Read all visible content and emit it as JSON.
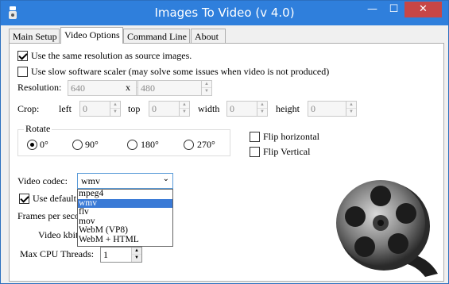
{
  "window": {
    "title": "Images To Video (v 4.0)",
    "minimize": "—",
    "maximize": "☐",
    "close": "✕"
  },
  "tabs": [
    "Main Setup",
    "Video Options",
    "Command Line",
    "About"
  ],
  "options": {
    "same_resolution": {
      "label": "Use the same resolution as source images.",
      "checked": true
    },
    "slow_scaler": {
      "label": "Use slow software scaler (may solve some issues when video is not produced)",
      "checked": false
    }
  },
  "resolution": {
    "label": "Resolution:",
    "width": "640",
    "x_sep": "x",
    "height": "480"
  },
  "crop": {
    "label": "Crop:",
    "left_label": "left",
    "left": "0",
    "top_label": "top",
    "top": "0",
    "width_label": "width",
    "width": "0",
    "height_label": "height",
    "height": "0"
  },
  "rotate": {
    "label": "Rotate",
    "options": [
      "0°",
      "90°",
      "180°",
      "270°"
    ],
    "selected": "0°"
  },
  "flip": {
    "horizontal_label": "Flip horizontal",
    "vertical_label": "Flip Vertical"
  },
  "video_codec": {
    "label": "Video codec:",
    "value": "wmv",
    "options": [
      "mpeg4",
      "wmv",
      "flv",
      "mov",
      "WebM (VP8)",
      "WebM + HTML"
    ],
    "selected_index": 1
  },
  "use_default": {
    "label": "Use default",
    "checked": true
  },
  "fps": {
    "label": "Frames per seco"
  },
  "kbit": {
    "label": "Video kbit"
  },
  "cpu": {
    "label": "Max CPU Threads:",
    "value": "1"
  },
  "colors": {
    "titlebar": "#2f7fdc",
    "close": "#c74646",
    "selection": "#3a7ad6"
  },
  "icons": {
    "app": "app-icon",
    "reel": "film-reel-icon"
  }
}
